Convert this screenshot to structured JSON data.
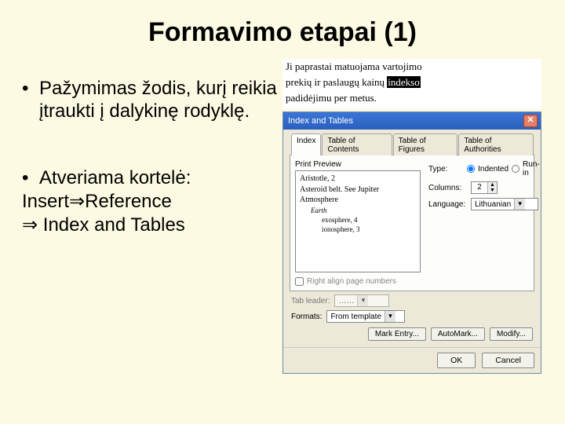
{
  "title": "Formavimo etapai (1)",
  "bullet1": "Pažymimas žodis, kurį reikia įtraukti į dalykinę rodyklę.",
  "bullet2_a": "Atveriama kortelė:",
  "bullet2_b_pre": "Insert",
  "bullet2_b_mid": "Reference",
  "bullet2_c": " Index and Tables",
  "arrow": "⇒",
  "sample": {
    "l1": "Ji paprastai matuojama vartojimo",
    "l2a": "prekių ir paslaugų kainų ",
    "l2b": "indekso",
    "l3": "padidėjimu per metus."
  },
  "dialog": {
    "title": "Index and Tables",
    "tabs": [
      "Index",
      "Table of Contents",
      "Table of Figures",
      "Table of Authorities"
    ],
    "preview_label": "Print Preview",
    "preview_lines": {
      "a": "Aristotle, 2",
      "b": "Asteroid belt. See Jupiter",
      "c": "Atmosphere",
      "d": "Earth",
      "e": "exosphere, 4",
      "f": "ionosphere, 3"
    },
    "right_align": "Right align page numbers",
    "type_label": "Type:",
    "type_opts": [
      "Indented",
      "Run-in"
    ],
    "columns_label": "Columns:",
    "columns_val": "2",
    "lang_label": "Language:",
    "lang_val": "Lithuanian",
    "tab_leader": "Tab leader:",
    "tab_leader_val": "……",
    "formats": "Formats:",
    "formats_val": "From template",
    "mark_entry": "Mark Entry...",
    "automark": "AutoMark...",
    "modify": "Modify...",
    "ok": "OK",
    "cancel": "Cancel"
  }
}
